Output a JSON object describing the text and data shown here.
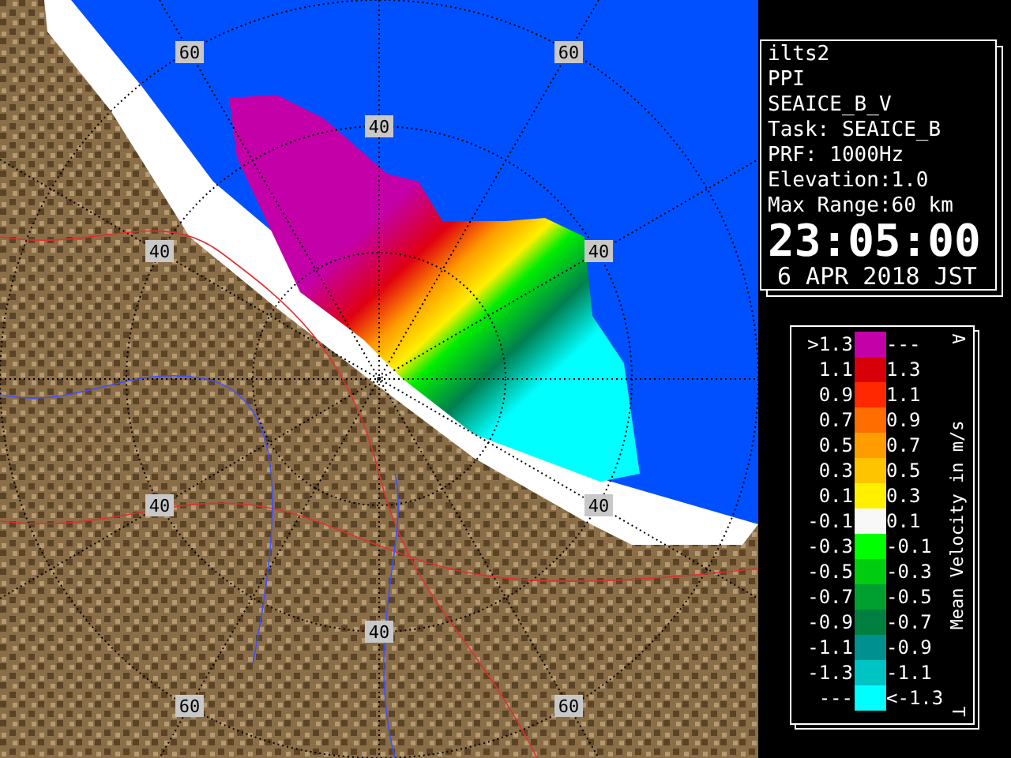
{
  "map": {
    "range_labels": [
      "60",
      "60",
      "40",
      "40",
      "40",
      "40",
      "40",
      "40",
      "60",
      "60"
    ]
  },
  "info": {
    "lines": [
      "ilts2",
      "PPI",
      "SEAICE_B_V",
      "Task: SEAICE_B",
      "PRF: 1000Hz",
      "Elevation:1.0",
      "Max Range:60 km"
    ],
    "time": "23:05:00",
    "date": "6 APR 2018 JST"
  },
  "legend": {
    "title": "Mean Velocity in m/s",
    "top_mark": "A",
    "bottom_mark": "T",
    "rows": [
      {
        "low": ">1.3",
        "high": "---",
        "color": "#c400a8"
      },
      {
        "low": "1.1",
        "high": "1.3",
        "color": "#d80008"
      },
      {
        "low": "0.9",
        "high": "1.1",
        "color": "#ff2800"
      },
      {
        "low": "0.7",
        "high": "0.9",
        "color": "#ff6c00"
      },
      {
        "low": "0.5",
        "high": "0.7",
        "color": "#ff9c00"
      },
      {
        "low": "0.3",
        "high": "0.5",
        "color": "#ffc400"
      },
      {
        "low": "0.1",
        "high": "0.3",
        "color": "#fff000"
      },
      {
        "low": "-0.1",
        "high": "0.1",
        "color": "#f8f8f8"
      },
      {
        "low": "-0.3",
        "high": "-0.1",
        "color": "#00ff00"
      },
      {
        "low": "-0.5",
        "high": "-0.3",
        "color": "#00cc10"
      },
      {
        "low": "-0.7",
        "high": "-0.5",
        "color": "#00a030"
      },
      {
        "low": "-0.9",
        "high": "-0.7",
        "color": "#008040"
      },
      {
        "low": "-1.1",
        "high": "-0.9",
        "color": "#009090"
      },
      {
        "low": "-1.3",
        "high": "-1.1",
        "color": "#00c4c4"
      },
      {
        "low": "---",
        "high": "<-1.3",
        "color": "#00ffff"
      }
    ]
  }
}
